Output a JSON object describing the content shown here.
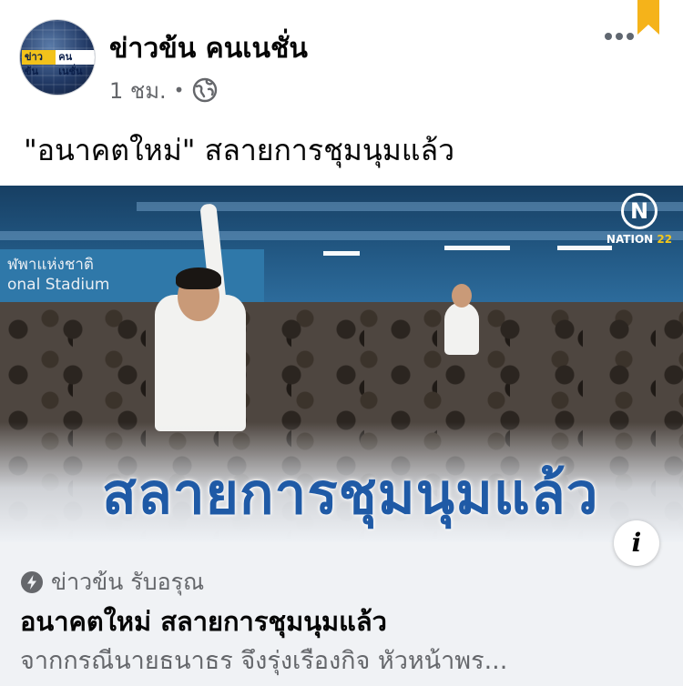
{
  "post": {
    "author_name": "ข่าวข้น คนเนชั่น",
    "timestamp": "1 ชม.",
    "separator": "•",
    "privacy_icon": "globe-icon",
    "text": "\"อนาคตใหม่\" สลายการชุมนุมแล้ว"
  },
  "avatar": {
    "badge_left": "ข่าวข้น",
    "badge_right": "คนเนชั่น"
  },
  "image": {
    "station_sign_line1": "ฬพาแห่งชาติ",
    "station_sign_line2": "onal Stadium",
    "logo_letter": "N",
    "logo_text": "NATION",
    "logo_number": "22",
    "headline": "สลายการชุมนุมแล้ว",
    "info_label": "i"
  },
  "link_preview": {
    "source_icon": "bolt-icon",
    "source": "ข่าวข้น รับอรุณ",
    "title": "อนาคตใหม่ สลายการชุมนุมแล้ว",
    "description": "จากกรณีนายธนาธร จึงรุ่งเรืองกิจ หัวหน้าพร..."
  },
  "colors": {
    "accent_blue": "#1f5aa6",
    "bookmark": "#f5b31a",
    "secondary_text": "#65676b",
    "preview_bg": "#f0f2f5"
  }
}
